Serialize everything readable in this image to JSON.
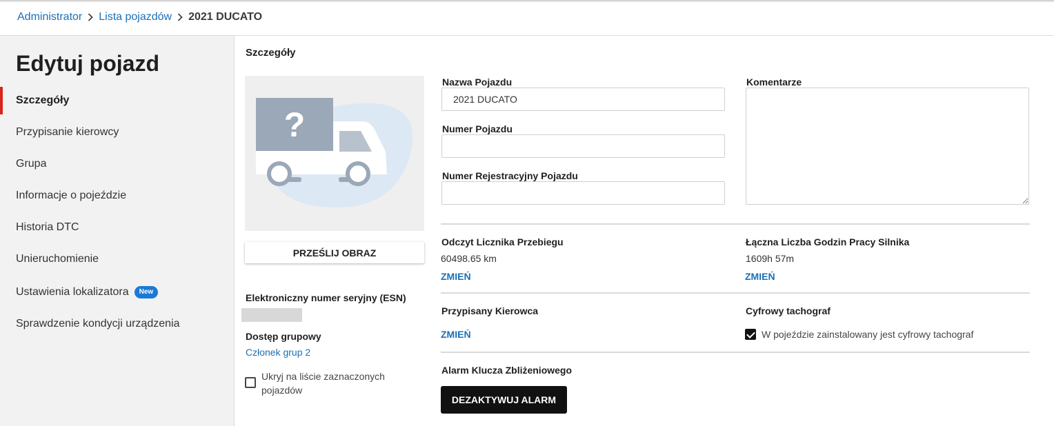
{
  "breadcrumb": {
    "items": [
      "Administrator",
      "Lista pojazdów"
    ],
    "current": "2021 DUCATO"
  },
  "sidebar": {
    "title": "Edytuj pojazd",
    "items": [
      {
        "label": "Szczegóły",
        "active": true
      },
      {
        "label": "Przypisanie kierowcy"
      },
      {
        "label": "Grupa"
      },
      {
        "label": "Informacje o pojeździe"
      },
      {
        "label": "Historia DTC"
      },
      {
        "label": "Unieruchomienie"
      },
      {
        "label": "Ustawienia lokalizatora",
        "badge": "New"
      },
      {
        "label": "Sprawdzenie kondycji urządzenia"
      }
    ],
    "accent_color": "#d8261d",
    "badge_color": "#1a7ad6"
  },
  "details": {
    "section_title": "Szczegóły",
    "image": {
      "icon": "unknown-vehicle-truck-icon"
    },
    "upload_button": "PRZEŚLIJ OBRAZ",
    "esn_label": "Elektroniczny numer seryjny (ESN)",
    "group_access_label": "Dostęp grupowy",
    "group_member_link": "Członek grup 2",
    "hide_checkbox_label_line1": "Ukryj na liście zaznaczonych",
    "hide_checkbox_label_line2": "pojazdów",
    "hide_checkbox_checked": false
  },
  "form": {
    "vehicle_name_label": "Nazwa Pojazdu",
    "vehicle_name_value": "2021 DUCATO",
    "vehicle_number_label": "Numer Pojazdu",
    "vehicle_number_value": "",
    "registration_label": "Numer Rejestracyjny Pojazdu",
    "registration_value": "",
    "comments_label": "Komentarze",
    "comments_value": ""
  },
  "odometer": {
    "label": "Odczyt Licznika Przebiegu",
    "value": "60498.65 km",
    "change": "ZMIEŃ"
  },
  "engine_hours": {
    "label": "Łączna Liczba Godzin Pracy Silnika",
    "value": "1609h 57m",
    "change": "ZMIEŃ"
  },
  "driver": {
    "label": "Przypisany Kierowca",
    "change": "ZMIEŃ"
  },
  "tachograph": {
    "label": "Cyfrowy tachograf",
    "checkbox_label": "W pojeździe zainstalowany jest cyfrowy tachograf",
    "checked": true
  },
  "alarm": {
    "label": "Alarm Klucza Zbliżeniowego",
    "button": "DEZAKTYWUJ ALARM"
  }
}
